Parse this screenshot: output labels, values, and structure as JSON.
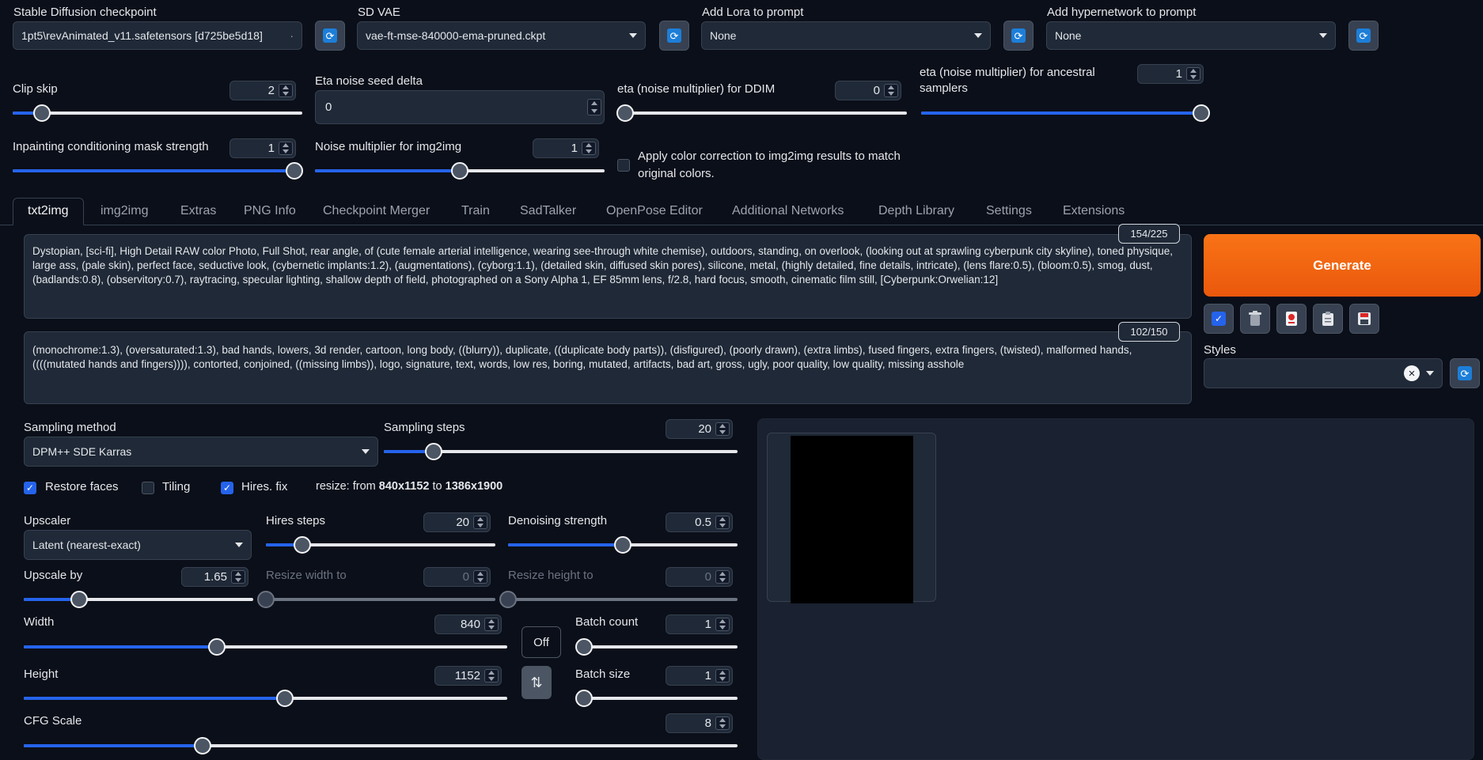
{
  "top": {
    "checkpoint": {
      "label": "Stable Diffusion checkpoint",
      "value": "1pt5\\revAnimated_v11.safetensors [d725be5d18]"
    },
    "vae": {
      "label": "SD VAE",
      "value": "vae-ft-mse-840000-ema-pruned.ckpt"
    },
    "lora": {
      "label": "Add Lora to prompt",
      "value": "None"
    },
    "hypernetwork": {
      "label": "Add hypernetwork to prompt",
      "value": "None"
    }
  },
  "settings": {
    "clip_skip": {
      "label": "Clip skip",
      "value": "2",
      "level": 0.1
    },
    "eta_seed_delta": {
      "label": "Eta noise seed delta",
      "value": "0"
    },
    "eta_ddim": {
      "label": "eta (noise multiplier) for DDIM",
      "value": "0",
      "level": 0
    },
    "eta_ancestral": {
      "label": "eta (noise multiplier) for ancestral samplers",
      "value": "1",
      "level": 1
    },
    "inpaint_mask": {
      "label": "Inpainting conditioning mask strength",
      "value": "1",
      "level": 1
    },
    "noise_img2img": {
      "label": "Noise multiplier for img2img",
      "value": "1",
      "level": 0.5
    },
    "color_correction": {
      "label": "Apply color correction to img2img results to match original colors.",
      "checked": false
    }
  },
  "tabs": [
    "txt2img",
    "img2img",
    "Extras",
    "PNG Info",
    "Checkpoint Merger",
    "Train",
    "SadTalker",
    "OpenPose Editor",
    "Additional Networks",
    "Depth Library",
    "Settings",
    "Extensions"
  ],
  "active_tab": "txt2img",
  "prompt": {
    "text": "Dystopian, [sci-fi], High Detail RAW color Photo, Full Shot, rear angle, of (cute female arterial intelligence, wearing see-through white chemise), outdoors, standing, on overlook, (looking out at sprawling cyberpunk city skyline), toned physique, large ass, (pale skin), perfect face, seductive look, (cybernetic implants:1.2), (augmentations), (cyborg:1.1), (detailed skin, diffused skin pores), silicone, metal, (highly detailed, fine details, intricate), (lens flare:0.5), (bloom:0.5), smog, dust, (badlands:0.8), (observitory:0.7), raytracing, specular lighting, shallow depth of field, photographed on a Sony Alpha 1, EF 85mm lens, f/2.8, hard focus, smooth, cinematic film still, [Cyberpunk:Orwelian:12]",
    "token_count": "154/225"
  },
  "negative_prompt": {
    "text": "(monochrome:1.3), (oversaturated:1.3), bad hands, lowers, 3d render, cartoon, long body, ((blurry)), duplicate, ((duplicate body parts)), (disfigured), (poorly drawn), (extra limbs), fused fingers, extra fingers, (twisted), malformed hands, ((((mutated hands and fingers)))), contorted, conjoined, ((missing limbs)), logo, signature, text, words, low res, boring, mutated, artifacts, bad art, gross, ugly, poor quality, low quality, missing asshole",
    "token_count": "102/150"
  },
  "right": {
    "generate_label": "Generate",
    "styles_label": "Styles",
    "styles_clear": "×"
  },
  "txt2img": {
    "sampling_method": {
      "label": "Sampling method",
      "value": "DPM++ SDE Karras"
    },
    "sampling_steps": {
      "label": "Sampling steps",
      "value": "20",
      "level": 0.14
    },
    "restore_faces": {
      "label": "Restore faces",
      "checked": true
    },
    "tiling": {
      "label": "Tiling",
      "checked": false
    },
    "hires_fix": {
      "label": "Hires. fix",
      "checked": true
    },
    "resize_prefix": "resize: from",
    "resize_from": "840x1152",
    "resize_to_word": "to",
    "resize_to": "1386x1900",
    "upscaler": {
      "label": "Upscaler",
      "value": "Latent (nearest-exact)"
    },
    "hires_steps": {
      "label": "Hires steps",
      "value": "20",
      "level": 0.16
    },
    "denoising": {
      "label": "Denoising strength",
      "value": "0.5",
      "level": 0.5
    },
    "upscale_by": {
      "label": "Upscale by",
      "value": "1.65",
      "level": 0.24
    },
    "resize_width": {
      "label": "Resize width to",
      "value": "0",
      "level": 0
    },
    "resize_height": {
      "label": "Resize height to",
      "value": "0",
      "level": 0
    },
    "width": {
      "label": "Width",
      "value": "840",
      "level": 0.4
    },
    "height": {
      "label": "Height",
      "value": "1152",
      "level": 0.54
    },
    "batch_count": {
      "label": "Batch count",
      "value": "1",
      "level": 0
    },
    "batch_size": {
      "label": "Batch size",
      "value": "1",
      "level": 0
    },
    "cfg_scale": {
      "label": "CFG Scale",
      "value": "8",
      "level": 0.25
    },
    "off_label": "Off",
    "swap_icon": "⇅"
  }
}
